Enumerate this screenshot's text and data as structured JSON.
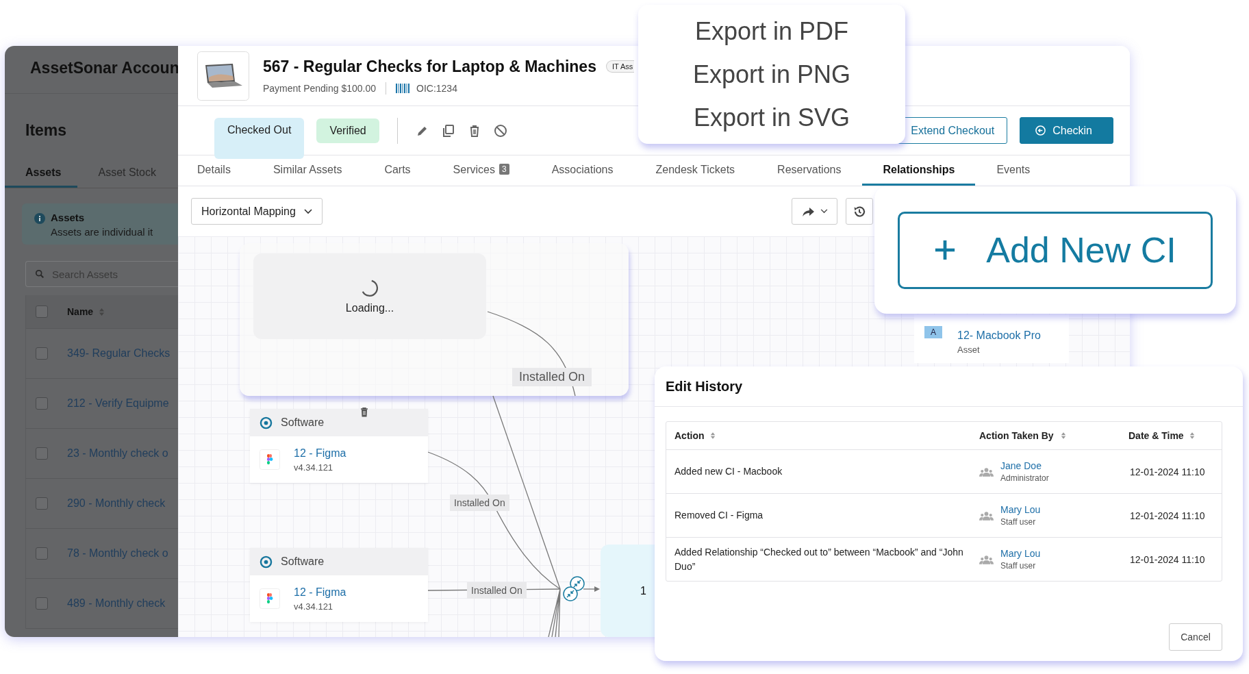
{
  "sidebar": {
    "title": "AssetSonar Accoun",
    "heading": "Items",
    "tabs": [
      {
        "label": "Assets",
        "selected": true
      },
      {
        "label": "Asset Stock",
        "selected": false
      }
    ],
    "info": {
      "title": "Assets",
      "text": "Assets are individual it"
    },
    "search": {
      "placeholder": "Search Assets"
    },
    "select_all": {
      "checked": false
    },
    "columns": [
      "Name"
    ],
    "rows": [
      {
        "name": "349- Regular Checks",
        "checked": false
      },
      {
        "name": "212 - Verify Equipme",
        "checked": false
      },
      {
        "name": "23 - Monthly check o",
        "checked": false
      },
      {
        "name": "290 - Monthly check",
        "checked": false
      },
      {
        "name": "78 - Monthly check o",
        "checked": false
      },
      {
        "name": "489 - Monthly check",
        "checked": false
      }
    ]
  },
  "asset": {
    "title": "567 - Regular Checks for Laptop & Machines",
    "badge": "IT Ass",
    "payment": "Payment Pending $100.00",
    "code": "OIC:1234",
    "statuses": [
      {
        "label": "Checked Out",
        "kind": "info"
      },
      {
        "label": "Verified",
        "kind": "success"
      }
    ],
    "buttons": [
      {
        "label": "Extend Checkout",
        "kind": "outline"
      },
      {
        "label": "Checkin",
        "kind": "primary"
      }
    ]
  },
  "tabs": [
    {
      "label": "Details",
      "selected": false
    },
    {
      "label": "Similar Assets",
      "selected": false
    },
    {
      "label": "Carts",
      "selected": false
    },
    {
      "label": "Services",
      "selected": false,
      "badge": "3"
    },
    {
      "label": "Associations",
      "selected": false
    },
    {
      "label": "Zendesk Tickets",
      "selected": false
    },
    {
      "label": "Reservations",
      "selected": false
    },
    {
      "label": "Relationships",
      "selected": true
    },
    {
      "label": "Events",
      "selected": false
    }
  ],
  "toolbar": {
    "view": "Horizontal Mapping"
  },
  "diagram": {
    "loading": "Loading...",
    "nodes": [
      {
        "category": "Software",
        "name": "12 - Figma",
        "version": "v4.34.121"
      },
      {
        "category": "Software",
        "name": "12 - Figma",
        "version": "v4.34.121"
      }
    ],
    "edge_labels": [
      "Installed On",
      "Installed On",
      "Installed On"
    ],
    "target": {
      "label": "1"
    },
    "asset_node": {
      "badge": "A",
      "name": "12- Macbook Pro",
      "type": "Asset"
    }
  },
  "export_menu": [
    "Export in PDF",
    "Export in PNG",
    "Export in SVG"
  ],
  "add_ci": {
    "label": "Add New CI"
  },
  "edit_history": {
    "title": "Edit History",
    "columns": [
      "Action",
      "Action Taken By",
      "Date & Time"
    ],
    "rows": [
      {
        "action": "Added new CI - Macbook",
        "user": "Jane Doe",
        "role": "Administrator",
        "date": "12-01-2024 11:10"
      },
      {
        "action": "Removed CI - Figma",
        "user": "Mary Lou",
        "role": "Staff user",
        "date": "12-01-2024 11:10"
      },
      {
        "action": "Added Relationship “Checked out to” between “Macbook” and “John Duo”",
        "user": "Mary Lou",
        "role": "Staff user",
        "date": "12-01-2024 11:10"
      }
    ],
    "cancel": "Cancel"
  }
}
